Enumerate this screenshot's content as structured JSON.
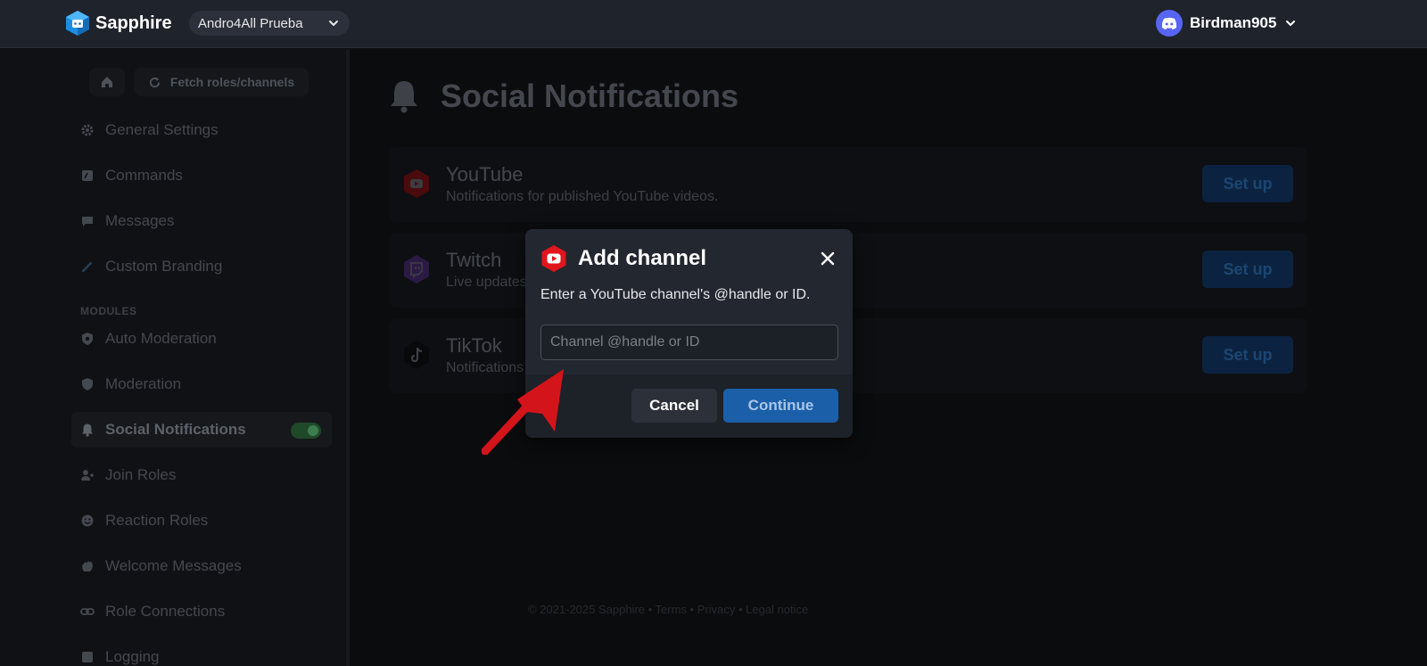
{
  "topbar": {
    "brand": "Sapphire",
    "guild_selector": "Andro4All Prueba",
    "user_name": "Birdman905"
  },
  "sidebar": {
    "fetch_label": "Fetch roles/channels",
    "items": [
      {
        "label": "General Settings",
        "icon": "gear-icon"
      },
      {
        "label": "Commands",
        "icon": "command-icon"
      },
      {
        "label": "Messages",
        "icon": "message-icon"
      },
      {
        "label": "Custom Branding",
        "icon": "brush-icon"
      }
    ],
    "section_label": "MODULES",
    "modules": [
      {
        "label": "Auto Moderation",
        "icon": "shield-gear-icon"
      },
      {
        "label": "Moderation",
        "icon": "shield-icon"
      },
      {
        "label": "Social Notifications",
        "icon": "bell-icon",
        "active": true,
        "enabled": true
      },
      {
        "label": "Join Roles",
        "icon": "user-plus-icon"
      },
      {
        "label": "Reaction Roles",
        "icon": "smile-icon"
      },
      {
        "label": "Welcome Messages",
        "icon": "wave-icon"
      },
      {
        "label": "Role Connections",
        "icon": "link-icon"
      },
      {
        "label": "Logging",
        "icon": "log-icon"
      }
    ]
  },
  "main": {
    "title": "Social Notifications",
    "cards": [
      {
        "name": "YouTube",
        "description": "Notifications for published YouTube videos.",
        "button": "Set up",
        "color": "#c4161c"
      },
      {
        "name": "Twitch",
        "description": "Live updates",
        "button": "Set up",
        "color": "#6441a5"
      },
      {
        "name": "TikTok",
        "description": "Notifications",
        "button": "Set up",
        "color": "#111111"
      }
    ],
    "footer": "© 2021-2025 Sapphire  •  Terms  •  Privacy  •  Legal notice"
  },
  "modal": {
    "title": "Add channel",
    "instruction": "Enter a YouTube channel's @handle or ID.",
    "input_value": "",
    "input_placeholder": "Channel @handle or ID",
    "cancel_label": "Cancel",
    "continue_label": "Continue"
  },
  "colors": {
    "accent": "#1b5fa8",
    "youtube_red": "#e0161c",
    "discord": "#5865f2",
    "annotation_arrow": "#d4141b"
  }
}
